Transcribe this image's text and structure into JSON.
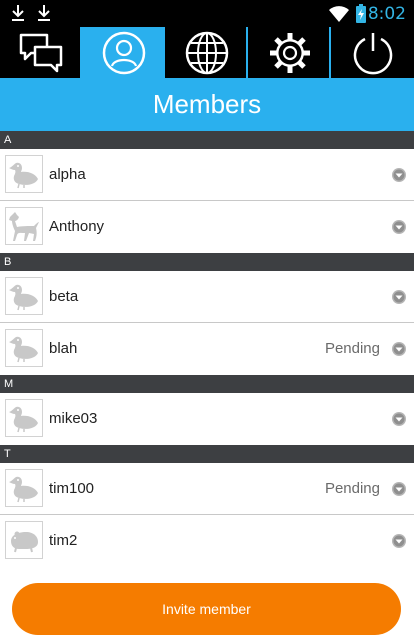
{
  "status_bar": {
    "time": "8:02",
    "icons": [
      "download-icon",
      "download-icon",
      "wifi-icon",
      "battery-icon"
    ]
  },
  "tabs": [
    {
      "icon": "chat-icon",
      "active": false
    },
    {
      "icon": "user-icon",
      "active": true
    },
    {
      "icon": "globe-icon",
      "active": false
    },
    {
      "icon": "gear-icon",
      "active": false
    },
    {
      "icon": "power-icon",
      "active": false
    }
  ],
  "header": {
    "title": "Members"
  },
  "sections": [
    {
      "letter": "A",
      "members": [
        {
          "name": "alpha",
          "status": "",
          "avatar": "duck-icon"
        },
        {
          "name": "Anthony",
          "status": "",
          "avatar": "dog-icon"
        }
      ]
    },
    {
      "letter": "B",
      "members": [
        {
          "name": "beta",
          "status": "",
          "avatar": "duck-icon"
        },
        {
          "name": "blah",
          "status": "Pending",
          "avatar": "duck-icon"
        }
      ]
    },
    {
      "letter": "M",
      "members": [
        {
          "name": "mike03",
          "status": "",
          "avatar": "duck-icon"
        }
      ]
    },
    {
      "letter": "T",
      "members": [
        {
          "name": "tim100",
          "status": "Pending",
          "avatar": "duck-icon"
        },
        {
          "name": "tim2",
          "status": "",
          "avatar": "hamster-icon"
        }
      ]
    }
  ],
  "invite_button": {
    "label": "Invite member"
  },
  "colors": {
    "accent": "#2ab0ee",
    "button": "#f57c00",
    "section_bg": "#3d3f42"
  }
}
